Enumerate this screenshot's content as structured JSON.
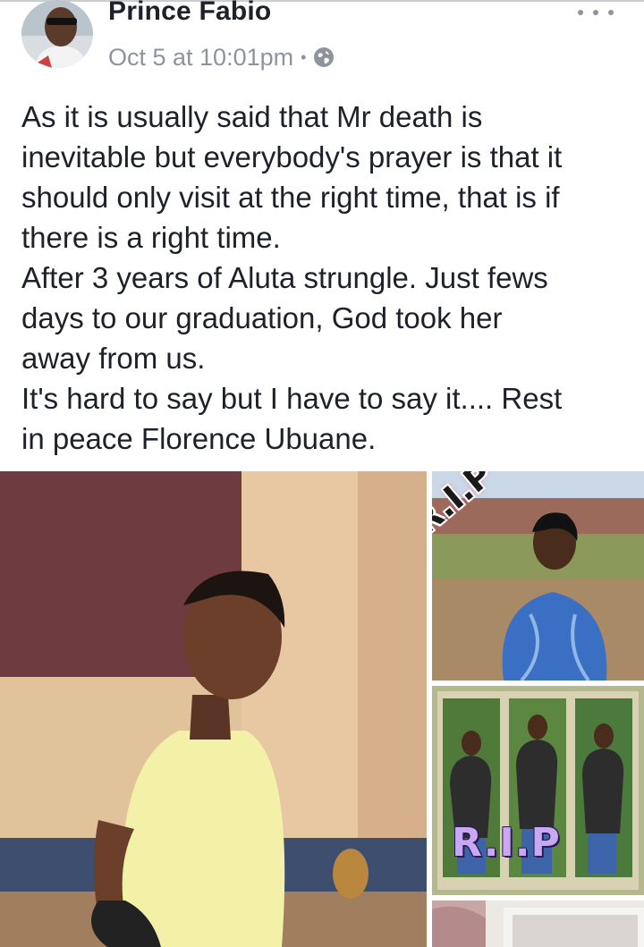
{
  "post": {
    "author": "Prince Fabio",
    "timestamp": "Oct 5 at 10:01pm",
    "separator": "•",
    "privacy_icon": "globe-icon",
    "more_icon": "more-options-icon",
    "text_lines": [
      "As it is usually said that Mr death is",
      "inevitable but everybody's prayer is that it",
      "should only visit at the right time, that is if",
      "there is a right time.",
      "After 3 years of Aluta strungle. Just fews",
      "days to our graduation, God took her",
      "away from us.",
      "It's hard to say but I have to say it.... Rest",
      "in peace Florence Ubuane."
    ]
  },
  "photos": {
    "top_right_overlay": "R.I.P",
    "middle_right_overlay": "R.I.P"
  },
  "colors": {
    "text": "#1d2129",
    "meta": "#8d949e"
  }
}
